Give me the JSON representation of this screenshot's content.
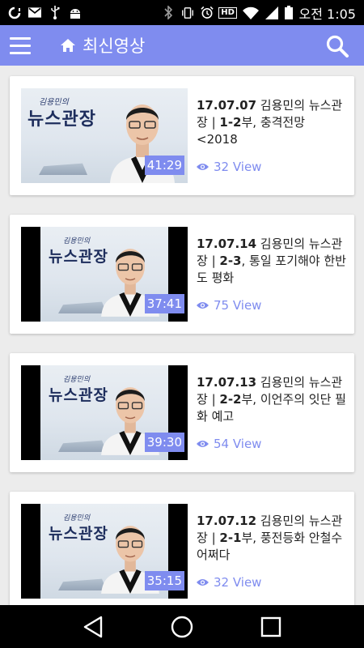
{
  "status_bar": {
    "left_icons": [
      "opera-icon",
      "mail-icon",
      "usb-icon",
      "android-icon"
    ],
    "right_icons": [
      "bluetooth-icon",
      "vibrate-icon",
      "alarm-icon",
      "hd-icon",
      "wifi-icon",
      "signal-icon",
      "battery-icon"
    ],
    "hd_label": "HD",
    "time": "오전 1:05"
  },
  "app_bar": {
    "title": "최신영상",
    "menu_icon": "menu-icon",
    "home_icon": "home-icon",
    "search_icon": "search-icon",
    "color": "#7f8cef"
  },
  "thumbnail_logo": {
    "small": "김용민의",
    "big": "뉴스관장"
  },
  "videos": [
    {
      "date": "17.07.07",
      "title_rest": " 김용민의 뉴스관장 | ",
      "part": "1-2",
      "suffix": "부, 충격전망 <2018",
      "duration": "41:29",
      "views": "32 View",
      "thumb_style": "full"
    },
    {
      "date": "17.07.14",
      "title_rest": " 김용민의 뉴스관장 | ",
      "part": "2-3",
      "suffix": ", 통일 포기해야 한반도 평화",
      "duration": "37:41",
      "views": "75 View",
      "thumb_style": "boxed"
    },
    {
      "date": "17.07.13",
      "title_rest": " 김용민의 뉴스관장 | ",
      "part": "2-2",
      "suffix": "부, 이언주의 잇단 필화 예고",
      "duration": "39:30",
      "views": "54 View",
      "thumb_style": "boxed"
    },
    {
      "date": "17.07.12",
      "title_rest": " 김용민의 뉴스관장 | ",
      "part": "2-1",
      "suffix": "부, 풍전등화 안철수 어쩌다",
      "duration": "35:15",
      "views": "32 View",
      "thumb_style": "boxed"
    }
  ],
  "nav_bar": {
    "back_icon": "back-icon",
    "home_icon": "home-circle-icon",
    "recents_icon": "recents-icon"
  }
}
